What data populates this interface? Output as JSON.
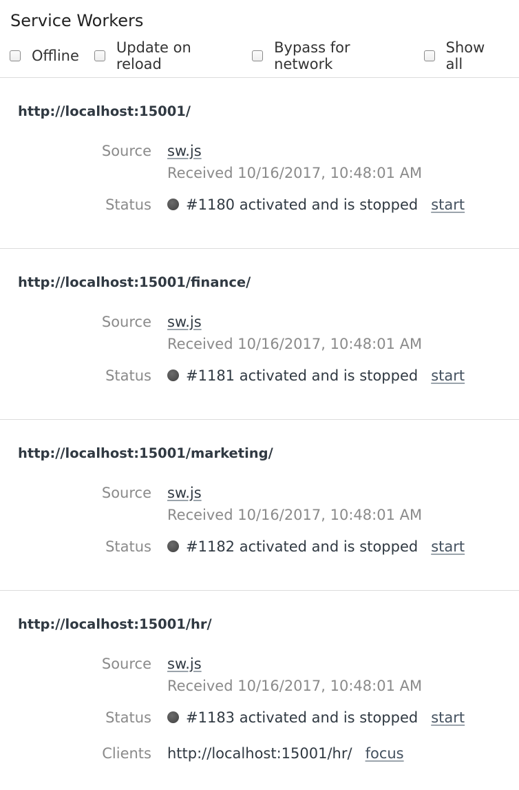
{
  "title": "Service Workers",
  "toolbar": {
    "options": [
      {
        "label": "Offline",
        "checked": false
      },
      {
        "label": "Update on reload",
        "checked": false
      },
      {
        "label": "Bypass for network",
        "checked": false
      },
      {
        "label": "Show all",
        "checked": false
      }
    ]
  },
  "labels": {
    "source": "Source",
    "status": "Status",
    "clients": "Clients"
  },
  "workers": [
    {
      "scope": "http://localhost:15001/",
      "source": "sw.js",
      "received": "Received 10/16/2017, 10:48:01 AM",
      "status": "#1180 activated and is stopped",
      "action": "start"
    },
    {
      "scope": "http://localhost:15001/finance/",
      "source": "sw.js",
      "received": "Received 10/16/2017, 10:48:01 AM",
      "status": "#1181 activated and is stopped",
      "action": "start"
    },
    {
      "scope": "http://localhost:15001/marketing/",
      "source": "sw.js",
      "received": "Received 10/16/2017, 10:48:01 AM",
      "status": "#1182 activated and is stopped",
      "action": "start"
    },
    {
      "scope": "http://localhost:15001/hr/",
      "source": "sw.js",
      "received": "Received 10/16/2017, 10:48:01 AM",
      "status": "#1183 activated and is stopped",
      "action": "start",
      "client": "http://localhost:15001/hr/",
      "client_action": "focus"
    }
  ],
  "colors": {
    "status_dot": "#545454",
    "divider": "#dcdcdc",
    "label": "#8a8a8a",
    "link": "#44515f"
  },
  "icons": {
    "status": "status-dot-icon",
    "checkbox": "checkbox-icon"
  }
}
